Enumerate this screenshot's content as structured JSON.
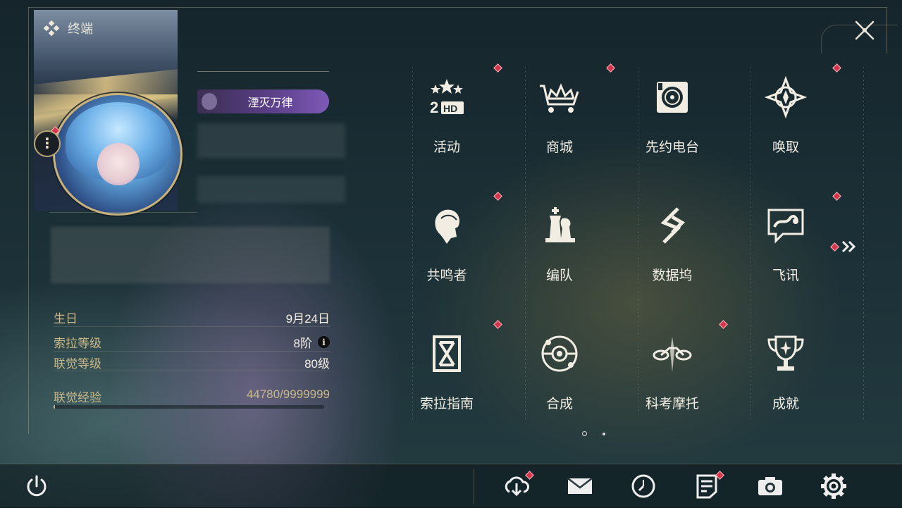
{
  "header": {
    "title": "终端",
    "terminal_icon": "diamond-cluster-icon",
    "close_icon": "close-x-icon"
  },
  "profile": {
    "title_badge": "湮灭万律",
    "more_icon": "more-vertical-icon",
    "stats": [
      {
        "label": "生日",
        "value": "9月24日"
      },
      {
        "label": "索拉等级",
        "value": "8阶"
      },
      {
        "label": "联觉等级",
        "value": "80级"
      }
    ],
    "info_glyph": "i",
    "xp": {
      "label": "联觉经验",
      "value": "44780/9999999",
      "fraction": 0.0045
    }
  },
  "menu": [
    {
      "label": "活动",
      "icon": "activity-2hd-icon",
      "badge": true
    },
    {
      "label": "商城",
      "icon": "shop-crown-cart-icon",
      "badge": true
    },
    {
      "label": "先约电台",
      "icon": "radio-icon",
      "badge": false
    },
    {
      "label": "唤取",
      "icon": "compass-star-icon",
      "badge": true
    },
    {
      "label": "共鸣者",
      "icon": "resonator-head-icon",
      "badge": true
    },
    {
      "label": "编队",
      "icon": "chess-team-icon",
      "badge": false
    },
    {
      "label": "数据坞",
      "icon": "data-dock-icon",
      "badge": false
    },
    {
      "label": "飞讯",
      "icon": "chat-message-icon",
      "badge": true
    },
    {
      "label": "索拉指南",
      "icon": "guide-book-icon",
      "badge": true
    },
    {
      "label": "合成",
      "icon": "synthesis-orbit-icon",
      "badge": false
    },
    {
      "label": "科考摩托",
      "icon": "motorbike-icon",
      "badge": true
    },
    {
      "label": "成就",
      "icon": "trophy-icon",
      "badge": false
    }
  ],
  "pagination": {
    "next_icon": "double-chevron-right-icon",
    "next_badge": true,
    "pages": 2,
    "current": 1
  },
  "bottom_bar": {
    "power_icon": "power-icon",
    "items": [
      {
        "icon": "cloud-download-icon",
        "badge": true
      },
      {
        "icon": "mail-icon",
        "badge": false
      },
      {
        "icon": "clock-icon",
        "badge": false
      },
      {
        "icon": "notice-document-icon",
        "badge": true
      },
      {
        "icon": "camera-icon",
        "badge": false
      },
      {
        "icon": "settings-gear-icon",
        "badge": false
      }
    ]
  },
  "colors": {
    "accent_gold": "#c9b889",
    "badge_red": "#d4374c",
    "text_light": "#f1ede3",
    "title_purple": "#5b3f88"
  }
}
